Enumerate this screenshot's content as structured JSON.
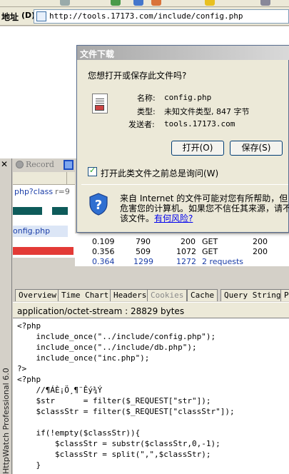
{
  "browser": {
    "address_label": "地址",
    "address_hotkey": "(D)",
    "url": "http://tools.17173.com/include/config.php"
  },
  "httpwatch": {
    "record_label": "Record",
    "product_name": "HttpWatch Professional 6.0",
    "requests": [
      {
        "url": "php?class",
        "url_rest": "r=9"
      },
      {
        "url": "onfig.php"
      }
    ],
    "rows": [
      {
        "time": "0.109",
        "received": "790",
        "sent": "200",
        "method": "GET",
        "result": "200"
      },
      {
        "time": "0.356",
        "received": "509",
        "sent": "1072",
        "method": "GET",
        "result": "200"
      }
    ],
    "summary": {
      "time": "0.364",
      "received": "1299",
      "sent": "1272",
      "label": "2 requests"
    },
    "tabs": [
      "Overview",
      "Time Chart",
      "Headers",
      "Cookies",
      "Cache",
      "Query String",
      "PO"
    ],
    "disabled_tab": "Cookies",
    "content_type": "application/octet-stream : 28829 bytes",
    "code_lines": [
      "<?php",
      "    include_once(\"../include/config.php\");",
      "    include_once(\"../include/db.php\");",
      "    include_once(\"inc.php\");",
      "?>",
      "<?php",
      "    //¶ÁÈ¡Ö¸¶¨Êý¾Ý",
      "    $str      = filter($_REQUEST[\"str\"]);",
      "    $classStr = filter($_REQUEST[\"classStr\"]);",
      "",
      "    if(!empty($classStr)){",
      "        $classStr = substr($classStr,0,-1);",
      "        $classStr = split(\",\",$classStr);",
      "    }"
    ]
  },
  "dialog": {
    "title": "文件下载",
    "question": "您想打开或保存此文件吗?",
    "name_label": "名称:",
    "name_value": "config.php",
    "type_label": "类型:",
    "type_value": "未知文件类型, 847 字节",
    "from_label": "发送者:",
    "from_value": "tools.17173.com",
    "open_button": "打开(O)",
    "save_button": "保存(S)",
    "checkbox_label": "打开此类文件之前总是询问(W)",
    "checkbox_checked": true,
    "warning_line1": "来自 Internet 的文件可能对您有所帮助，但",
    "warning_line2": "危害您的计算机。如果您不信任其来源，请不",
    "warning_line3_prefix": "该文件。",
    "warning_link": "有何风险?"
  },
  "colors": {
    "teal_bar": "#0e5b5a",
    "red_bar": "#e33a36",
    "link_blue": "#1b3ea8"
  }
}
